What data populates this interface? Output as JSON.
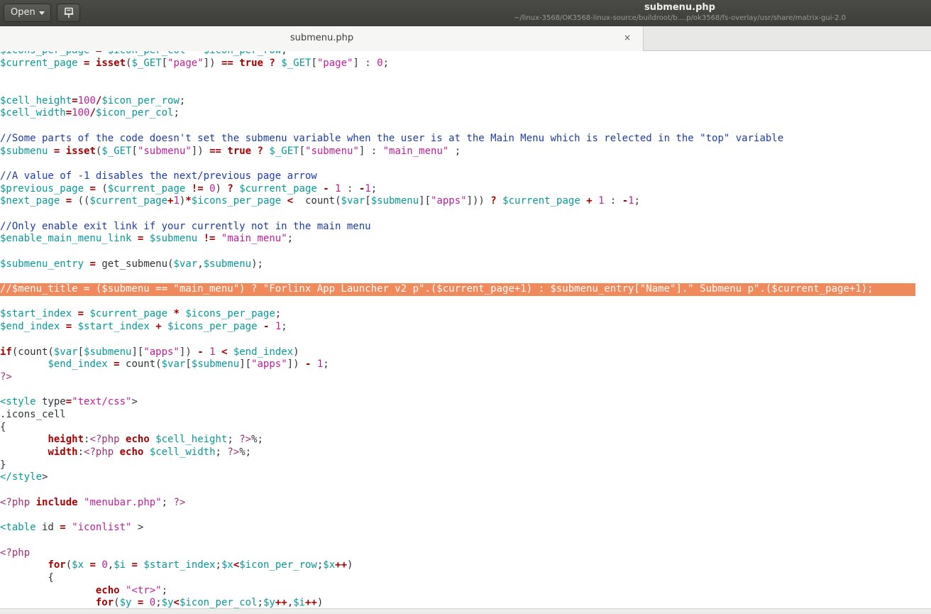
{
  "header": {
    "open_label": "Open",
    "title": "submenu.php",
    "path": "~/linux-3568/OK3568-linux-source/buildroot/b....p/ok3568/fs-overlay/usr/share/matrix-gui-2.0",
    "pin_icon": "pin-document-icon",
    "dropdown_icon": "chevron-down-icon"
  },
  "tab": {
    "label": "submenu.php",
    "close": "×"
  },
  "editor": {
    "highlight_color": "#f08a5d",
    "lines": [
      "$icons_per_page = $icon_per_col * $icon_per_row;",
      "$current_page = isset($_GET[\"page\"]) == true ? $_GET[\"page\"] : 0;",
      "",
      "",
      "$cell_height=100/$icon_per_row;",
      "$cell_width=100/$icon_per_col;",
      "",
      "//Some parts of the code doesn't set the submenu variable when the user is at the Main Menu which is relected in the \"top\" variable",
      "$submenu = isset($_GET[\"submenu\"]) == true ? $_GET[\"submenu\"] : \"main_menu\" ;",
      "",
      "//A value of -1 disables the next/previous page arrow",
      "$previous_page = ($current_page != 0) ? $current_page - 1 : -1;",
      "$next_page = (($current_page+1)*$icons_per_page <  count($var[$submenu][\"apps\"])) ? $current_page + 1 : -1;",
      "",
      "//Only enable exit link if your currently not in the main menu",
      "$enable_main_menu_link = $submenu != \"main_menu\";",
      "",
      "$submenu_entry = get_submenu($var,$submenu);",
      "",
      "//$menu_title = ($submenu == \"main_menu\") ? \"Forlinx App Launcher v2 p\".($current_page+1) : $submenu_entry[\"Name\"].\" Submenu p\".($current_page+1);",
      "",
      "$start_index = $current_page * $icons_per_page;",
      "$end_index = $start_index + $icons_per_page - 1;",
      "",
      "if(count($var[$submenu][\"apps\"]) - 1 < $end_index)",
      "        $end_index = count($var[$submenu][\"apps\"]) - 1;",
      "?>",
      "",
      "<style type=\"text/css\">",
      ".icons_cell",
      "{",
      "        height:<?php echo $cell_height; ?>%;",
      "        width:<?php echo $cell_width; ?>%;",
      "}",
      "</style>",
      "",
      "<?php include \"menubar.php\"; ?>",
      "",
      "<table id = \"iconlist\" >",
      "",
      "<?php",
      "        for($x = 0,$i = $start_index;$x<$icon_per_row;$x++)",
      "        {",
      "                echo \"<tr>\";",
      "                for($y = 0;$y<$icon_per_col;$y++,$i++)"
    ]
  }
}
